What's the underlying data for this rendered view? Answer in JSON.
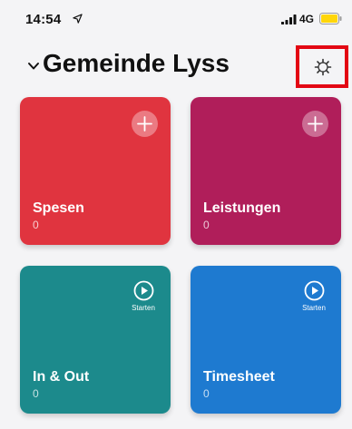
{
  "status_bar": {
    "time": "14:54",
    "network": "4G",
    "icons": [
      "location-arrow-icon",
      "signal-icon",
      "battery-icon"
    ],
    "battery_color": "#ffd60a"
  },
  "header": {
    "title": "Gemeinde Lyss",
    "chevron_icon": "chevron-down-icon",
    "settings_icon": "gear-icon",
    "highlight_color": "#e30613"
  },
  "tiles": [
    {
      "title": "Spesen",
      "count": "0",
      "color": "#e0343f",
      "action": "add",
      "action_icon": "plus-icon"
    },
    {
      "title": "Leistungen",
      "count": "0",
      "color": "#b01e5a",
      "action": "add",
      "action_icon": "plus-icon"
    },
    {
      "title": "In & Out",
      "count": "0",
      "color": "#1c8a8c",
      "action": "start",
      "action_icon": "play-icon",
      "action_label": "Starten"
    },
    {
      "title": "Timesheet",
      "count": "0",
      "color": "#1e7ad0",
      "action": "start",
      "action_icon": "play-icon",
      "action_label": "Starten"
    }
  ]
}
